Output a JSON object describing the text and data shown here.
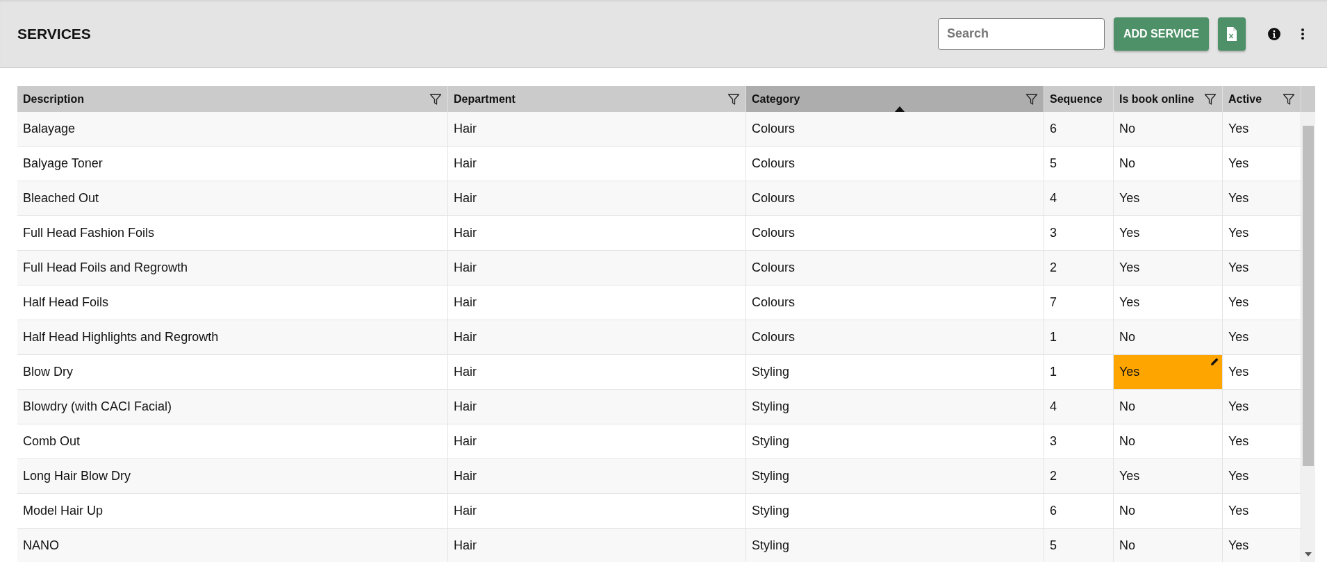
{
  "page_title": "SERVICES",
  "search": {
    "placeholder": "Search"
  },
  "add_button": "ADD SERVICE",
  "columns": [
    {
      "label": "Description",
      "filter": true,
      "sorted": false
    },
    {
      "label": "Department",
      "filter": true,
      "sorted": false
    },
    {
      "label": "Category",
      "filter": true,
      "sorted": true
    },
    {
      "label": "Sequence",
      "filter": false,
      "sorted": false
    },
    {
      "label": "Is book online",
      "filter": true,
      "sorted": false
    },
    {
      "label": "Active",
      "filter": true,
      "sorted": false
    }
  ],
  "rows": [
    {
      "cells": [
        "Balayage",
        "Hair",
        "Colours",
        "6",
        "No",
        "Yes"
      ],
      "book_online_editing": false
    },
    {
      "cells": [
        "Balyage Toner",
        "Hair",
        "Colours",
        "5",
        "No",
        "Yes"
      ],
      "book_online_editing": false
    },
    {
      "cells": [
        "Bleached Out",
        "Hair",
        "Colours",
        "4",
        "Yes",
        "Yes"
      ],
      "book_online_editing": false
    },
    {
      "cells": [
        "Full Head Fashion Foils",
        "Hair",
        "Colours",
        "3",
        "Yes",
        "Yes"
      ],
      "book_online_editing": false
    },
    {
      "cells": [
        "Full Head Foils and Regrowth",
        "Hair",
        "Colours",
        "2",
        "Yes",
        "Yes"
      ],
      "book_online_editing": false
    },
    {
      "cells": [
        "Half Head Foils",
        "Hair",
        "Colours",
        "7",
        "Yes",
        "Yes"
      ],
      "book_online_editing": false
    },
    {
      "cells": [
        "Half Head Highlights and Regrowth",
        "Hair",
        "Colours",
        "1",
        "No",
        "Yes"
      ],
      "book_online_editing": false
    },
    {
      "cells": [
        "Blow Dry",
        "Hair",
        "Styling",
        "1",
        "Yes",
        "Yes"
      ],
      "book_online_editing": true
    },
    {
      "cells": [
        "Blowdry (with CACI Facial)",
        "Hair",
        "Styling",
        "4",
        "No",
        "Yes"
      ],
      "book_online_editing": false
    },
    {
      "cells": [
        "Comb Out",
        "Hair",
        "Styling",
        "3",
        "No",
        "Yes"
      ],
      "book_online_editing": false
    },
    {
      "cells": [
        "Long Hair Blow Dry",
        "Hair",
        "Styling",
        "2",
        "Yes",
        "Yes"
      ],
      "book_online_editing": false
    },
    {
      "cells": [
        "Model Hair Up",
        "Hair",
        "Styling",
        "6",
        "No",
        "Yes"
      ],
      "book_online_editing": false
    },
    {
      "cells": [
        "NANO",
        "Hair",
        "Styling",
        "5",
        "No",
        "Yes"
      ],
      "book_online_editing": false
    }
  ]
}
